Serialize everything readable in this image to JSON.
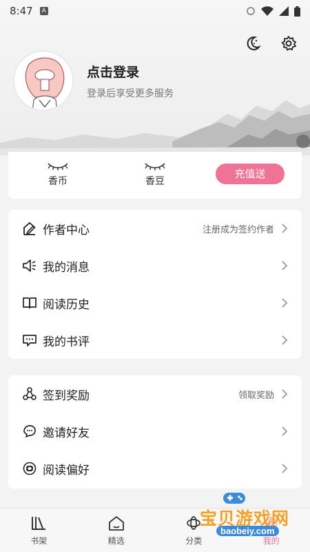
{
  "status_bar": {
    "time": "8:47"
  },
  "header": {
    "login_title": "点击登录",
    "login_subtitle": "登录后享受更多服务"
  },
  "icons": {
    "night_mode": "moon-stars-icon",
    "settings": "gear-icon"
  },
  "currency": {
    "coin_label": "香币",
    "bean_label": "香豆",
    "recharge_label": "充值送"
  },
  "menu_group1": [
    {
      "label": "作者中心",
      "hint": "注册成为签约作者",
      "icon": "pen-house-icon"
    },
    {
      "label": "我的消息",
      "hint": "",
      "icon": "speaker-icon"
    },
    {
      "label": "阅读历史",
      "hint": "",
      "icon": "book-icon"
    },
    {
      "label": "我的书评",
      "hint": "",
      "icon": "comment-icon"
    }
  ],
  "menu_group2": [
    {
      "label": "签到奖励",
      "hint": "领取奖励",
      "icon": "nodes-icon"
    },
    {
      "label": "邀请好友",
      "hint": "",
      "icon": "chat-bubbles-icon"
    },
    {
      "label": "阅读偏好",
      "hint": "",
      "icon": "target-icon"
    }
  ],
  "bottom_nav": [
    {
      "label": "书架",
      "icon": "bookshelf-icon"
    },
    {
      "label": "精选",
      "icon": "home-icon"
    },
    {
      "label": "分类",
      "icon": "category-icon"
    },
    {
      "label": "我的",
      "icon": "profile-icon"
    }
  ],
  "watermark": {
    "text_cn": "宝贝游戏网",
    "text_en": "baobeiy.com"
  },
  "colors": {
    "accent": "#f07295",
    "background": "#f3f3f3",
    "watermark": "#f5a023"
  }
}
